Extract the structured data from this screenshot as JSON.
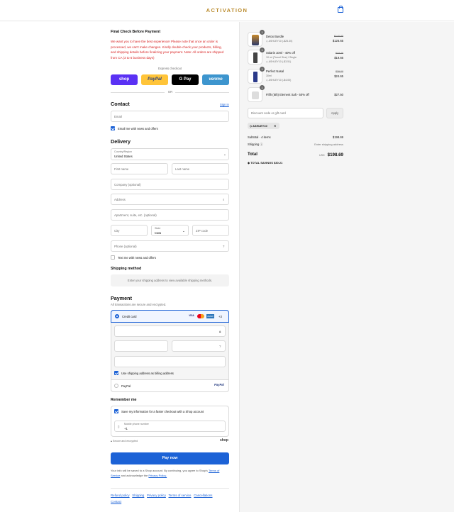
{
  "header": {
    "brand": "ACTIVATION"
  },
  "notice": {
    "title": "Final Check Before Payment",
    "body": "We want you to have the best experience! Please note that once an order is processed, we can't make changes. Kindly double-check your products, billing, and shipping details before finalizing your payment. Note: All orders are shipped from CA (3 to 6 business days)"
  },
  "express": {
    "label": "Express checkout",
    "shop": "shop",
    "paypal": "PayPal",
    "gpay": "G Pay",
    "venmo": "venmo",
    "or": "OR"
  },
  "contact": {
    "title": "Contact",
    "sign_in": "Sign in",
    "email_placeholder": "Email",
    "news_label": "Email me with news and offers"
  },
  "delivery": {
    "title": "Delivery",
    "country_label": "Country/Region",
    "country_value": "United States",
    "first_name": "First name",
    "last_name": "Last name",
    "company": "Company (optional)",
    "address": "Address",
    "apartment": "Apartment, suite, etc. (optional)",
    "city": "City",
    "state_label": "State",
    "state_value": "Iowa",
    "zip": "ZIP code",
    "phone": "Phone (optional)",
    "text_label": "Text me with news and offers"
  },
  "shipping": {
    "title": "Shipping method",
    "message": "Enter your shipping address to view available shipping methods."
  },
  "payment": {
    "title": "Payment",
    "subtitle": "All transactions are secure and encrypted.",
    "credit_card": "Credit card",
    "card_more": "+3",
    "card_brands": [
      "VISA",
      "MC",
      "AMEX"
    ],
    "billing_label": "Use shipping address as billing address",
    "paypal": "PayPal",
    "paypal_logo": "PayPal"
  },
  "remember": {
    "title": "Remember me",
    "save_label": "Save my information for a faster checkout with a Shop account",
    "phone_label": "Mobile phone number",
    "phone_value": "+1",
    "secure": "Secure and encrypted",
    "shop": "shop"
  },
  "pay_button": "Pay now",
  "legal": {
    "text": "Your info will be saved to a Shop account. By continuing, you agree to Shop's",
    "terms": "Terms of Service",
    "and": "and acknowledge the",
    "privacy": "Privacy Policy."
  },
  "footer_links": [
    "Refund policy",
    "Shipping",
    "Privacy policy",
    "Terms of service",
    "Cancellations",
    "Contact"
  ],
  "cart": {
    "items": [
      {
        "qty": "1",
        "name": "Detox Bundle",
        "variant": "",
        "discount": "ASHLEY10 (-$25.30)",
        "old_price": "$140.95",
        "price": "$126.65"
      },
      {
        "qty": "1",
        "name": "Solaris 10ml - 40% off",
        "variant": "10 ml (Travel Size) / Single",
        "discount": "ASHLEY10 (-$3.51)",
        "old_price": "$33.46",
        "price": "$19.66"
      },
      {
        "qty": "1",
        "name": "Perfect Nasal",
        "variant": "30ml",
        "discount": "ASHLEY10 (-$4.00)",
        "old_price": "$39.00",
        "price": "$24.65"
      },
      {
        "qty": "1",
        "name": "Fifth (5th) Element Salt - 50% off",
        "variant": "",
        "discount": "",
        "old_price": "",
        "price": "$27.50"
      }
    ],
    "discount_placeholder": "Discount code or gift card",
    "apply": "Apply",
    "applied_code": "ASHLEY10",
    "subtotal_label": "Subtotal · 4 items",
    "subtotal": "$198.69",
    "shipping_label": "Shipping",
    "shipping_value": "Enter shipping address",
    "total_label": "Total",
    "currency": "USD",
    "total": "$198.69",
    "savings_label": "TOTAL SAVINGS",
    "savings": "$30.21"
  }
}
